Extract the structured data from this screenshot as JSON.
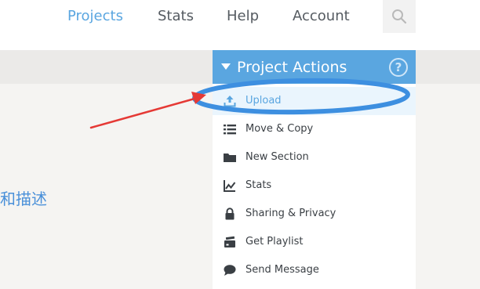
{
  "nav": {
    "items": [
      "Projects",
      "Stats",
      "Help",
      "Account"
    ],
    "active": "Projects"
  },
  "content": {
    "partial_text": "和描述"
  },
  "panel": {
    "title": "Project Actions",
    "help_glyph": "?",
    "items": [
      {
        "label": "Upload",
        "icon": "upload-icon",
        "highlighted": true
      },
      {
        "label": "Move & Copy",
        "icon": "list-icon",
        "highlighted": false
      },
      {
        "label": "New Section",
        "icon": "folder-icon",
        "highlighted": false
      },
      {
        "label": "Stats",
        "icon": "chart-icon",
        "highlighted": false
      },
      {
        "label": "Sharing & Privacy",
        "icon": "lock-icon",
        "highlighted": false
      },
      {
        "label": "Get Playlist",
        "icon": "playlist-icon",
        "highlighted": false
      },
      {
        "label": "Send Message",
        "icon": "message-icon",
        "highlighted": false
      }
    ]
  },
  "colors": {
    "accent": "#5aa6e0",
    "annotation_arrow": "#e53935",
    "annotation_circle": "#3d8fe0"
  }
}
